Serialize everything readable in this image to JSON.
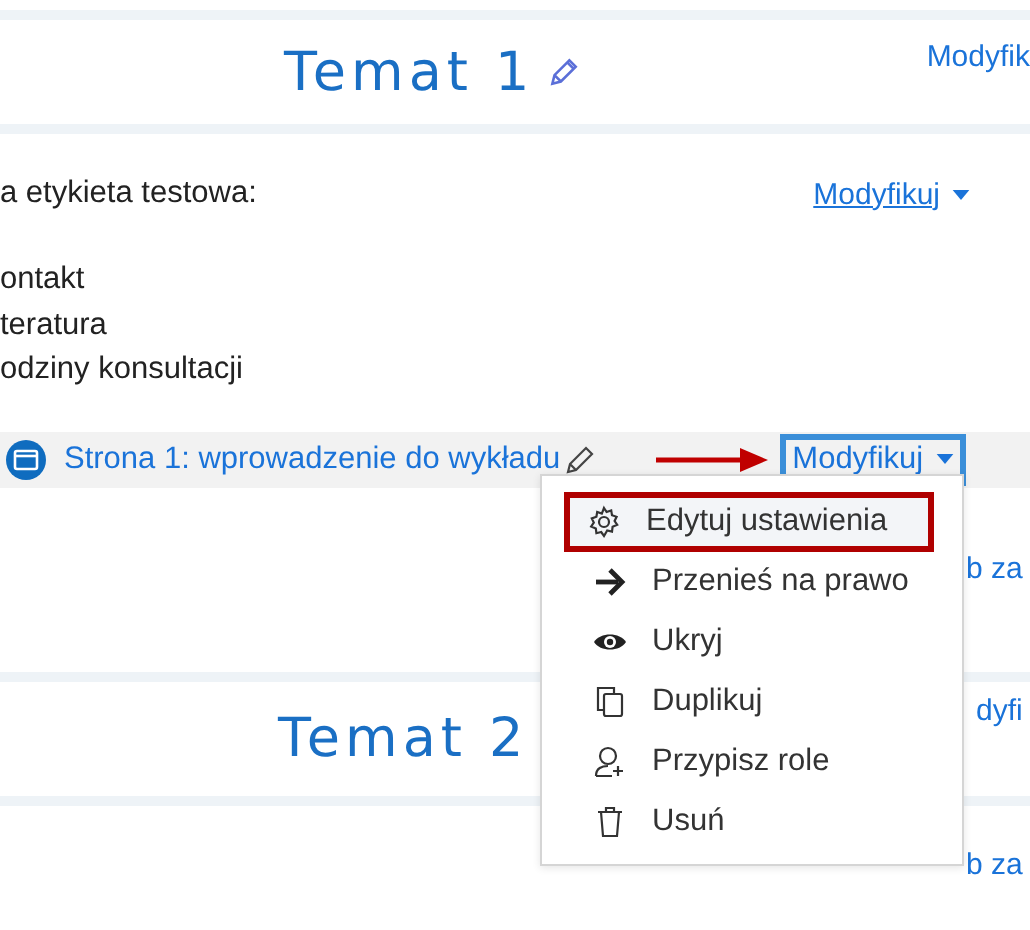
{
  "topic1": {
    "title": "Temat 1",
    "edit_link": "Modyfik"
  },
  "label": {
    "text": "a etykieta testowa:",
    "menu_link": "Modyfikuj",
    "items": [
      "ontakt",
      "teratura",
      "odziny konsultacji"
    ]
  },
  "activity": {
    "title": "Strona 1: wprowadzenie do wykładu",
    "menu_button": "Modyfikuj",
    "annotated": true
  },
  "add_link_1": "b za",
  "topic2": {
    "title": "Temat 2",
    "edit_link": "dyfi"
  },
  "add_link_2": "b za",
  "menu": {
    "items": [
      {
        "label": "Edytuj ustawienia",
        "kind": "gear",
        "selected": true
      },
      {
        "label": "Przenieś na prawo",
        "kind": "arrow",
        "selected": false
      },
      {
        "label": "Ukryj",
        "kind": "eye",
        "selected": false
      },
      {
        "label": "Duplikuj",
        "kind": "copy",
        "selected": false
      },
      {
        "label": "Przypisz role",
        "kind": "user",
        "selected": false
      },
      {
        "label": "Usuń",
        "kind": "trash",
        "selected": false
      }
    ]
  }
}
